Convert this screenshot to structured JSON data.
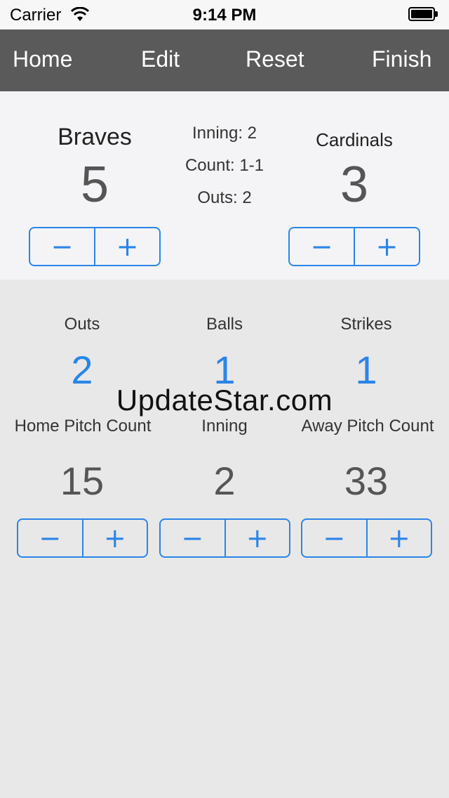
{
  "status_bar": {
    "carrier": "Carrier",
    "time": "9:14 PM"
  },
  "navbar": {
    "home": "Home",
    "edit": "Edit",
    "reset": "Reset",
    "finish": "Finish"
  },
  "scoreboard": {
    "home_team": {
      "name": "Braves",
      "score": "5"
    },
    "away_team": {
      "name": "Cardinals",
      "score": "3"
    },
    "inning_text": "Inning: 2",
    "count_text": "Count: 1-1",
    "outs_text": "Outs: 2"
  },
  "stepper": {
    "minus": "−",
    "plus": "+"
  },
  "stats": {
    "outs": {
      "label": "Outs",
      "value": "2"
    },
    "balls": {
      "label": "Balls",
      "value": "1"
    },
    "strikes": {
      "label": "Strikes",
      "value": "1"
    },
    "home_pitch": {
      "label": "Home Pitch Count",
      "value": "15"
    },
    "inning": {
      "label": "Inning",
      "value": "2"
    },
    "away_pitch": {
      "label": "Away Pitch Count",
      "value": "33"
    }
  },
  "watermark": "UpdateStar.com",
  "colors": {
    "accent": "#2a85e8",
    "navbar": "#5a5a5a",
    "background": "#e8e8e8",
    "scoreboard": "#f4f4f6"
  }
}
